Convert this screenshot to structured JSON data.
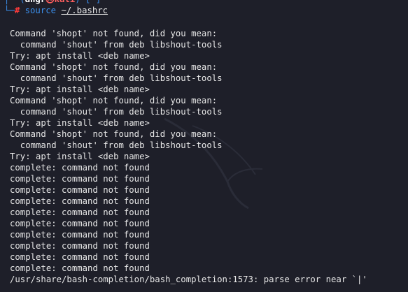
{
  "prompt": {
    "frame_top_left": "┌──(",
    "user": "angr",
    "at_symbol": "㉿",
    "host": "kali",
    "frame_mid": ")-[",
    "path": "~",
    "frame_end": "]",
    "frame_bottom": "└─",
    "hash": "#",
    "command": "source",
    "argument": "~/.bashrc"
  },
  "output": [
    "Command 'shopt' not found, did you mean:",
    "  command 'shout' from deb libshout-tools",
    "Try: apt install <deb name>",
    "Command 'shopt' not found, did you mean:",
    "  command 'shout' from deb libshout-tools",
    "Try: apt install <deb name>",
    "Command 'shopt' not found, did you mean:",
    "  command 'shout' from deb libshout-tools",
    "Try: apt install <deb name>",
    "Command 'shopt' not found, did you mean:",
    "  command 'shout' from deb libshout-tools",
    "Try: apt install <deb name>",
    "complete: command not found",
    "complete: command not found",
    "complete: command not found",
    "complete: command not found",
    "complete: command not found",
    "complete: command not found",
    "complete: command not found",
    "complete: command not found",
    "complete: command not found",
    "complete: command not found",
    "/usr/share/bash-completion/bash_completion:1573: parse error near `|'"
  ],
  "colors": {
    "background": "#1e1f29",
    "text": "#e6e6e6",
    "frame": "#3b8eea",
    "host": "#ff5f5f",
    "hash": "#ff3b3b"
  }
}
